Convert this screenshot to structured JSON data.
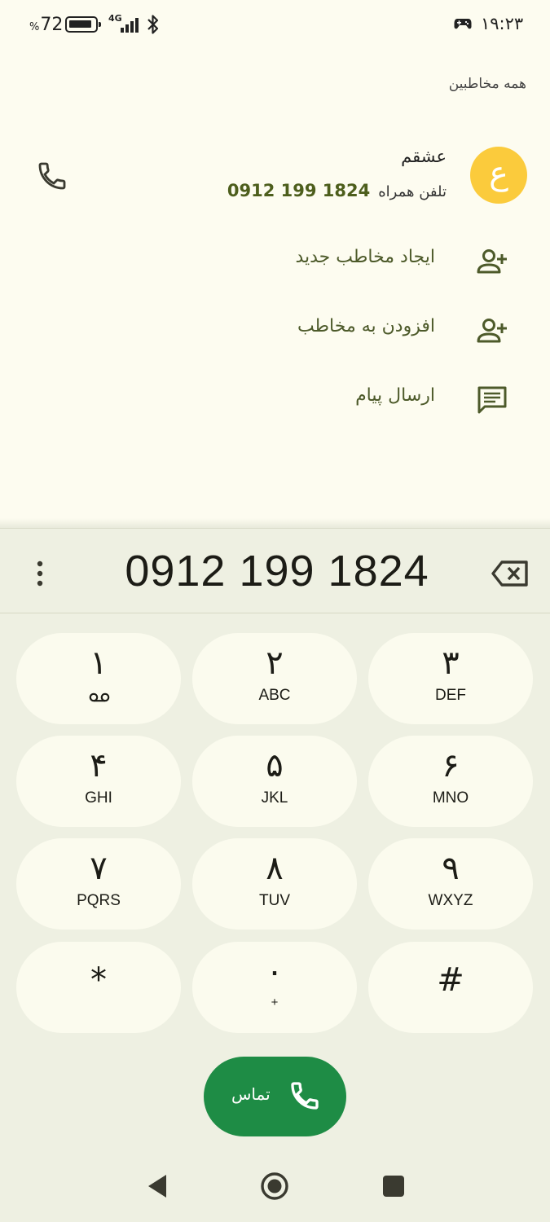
{
  "status_bar": {
    "battery_percent": "72",
    "percent_sign": "%",
    "network": "4G",
    "time": "۱۹:۲۳",
    "icons": [
      "battery-icon",
      "signal-icon",
      "bluetooth-icon",
      "game-icon"
    ]
  },
  "header": {
    "all_contacts": "همه مخاطبین"
  },
  "contact": {
    "avatar_letter": "ع",
    "name": "عشقم",
    "number_type": "تلفن همراه",
    "number": "0912 199 1824"
  },
  "actions": [
    {
      "label": "ایجاد مخاطب جدید",
      "icon": "add-person-icon"
    },
    {
      "label": "افزودن به مخاطب",
      "icon": "add-person-icon"
    },
    {
      "label": "ارسال پیام",
      "icon": "message-icon"
    }
  ],
  "dialer": {
    "dialed_number": "0912 199 1824",
    "keys": [
      {
        "digit": "۱",
        "letters": ""
      },
      {
        "digit": "۲",
        "letters": "ABC"
      },
      {
        "digit": "۳",
        "letters": "DEF"
      },
      {
        "digit": "۴",
        "letters": "GHI"
      },
      {
        "digit": "۵",
        "letters": "JKL"
      },
      {
        "digit": "۶",
        "letters": "MNO"
      },
      {
        "digit": "۷",
        "letters": "PQRS"
      },
      {
        "digit": "۸",
        "letters": "TUV"
      },
      {
        "digit": "۹",
        "letters": "WXYZ"
      },
      {
        "digit": "*",
        "letters": ""
      },
      {
        "digit": "۰",
        "letters": "+"
      },
      {
        "digit": "#",
        "letters": ""
      }
    ],
    "call_label": "تماس"
  },
  "colors": {
    "background": "#fdfcf0",
    "dialer_bg": "#eef0e2",
    "key_bg": "#fbfbee",
    "accent_green": "#1e8c45",
    "avatar_yellow": "#fbcb3c",
    "action_text": "#4d5a2a"
  }
}
